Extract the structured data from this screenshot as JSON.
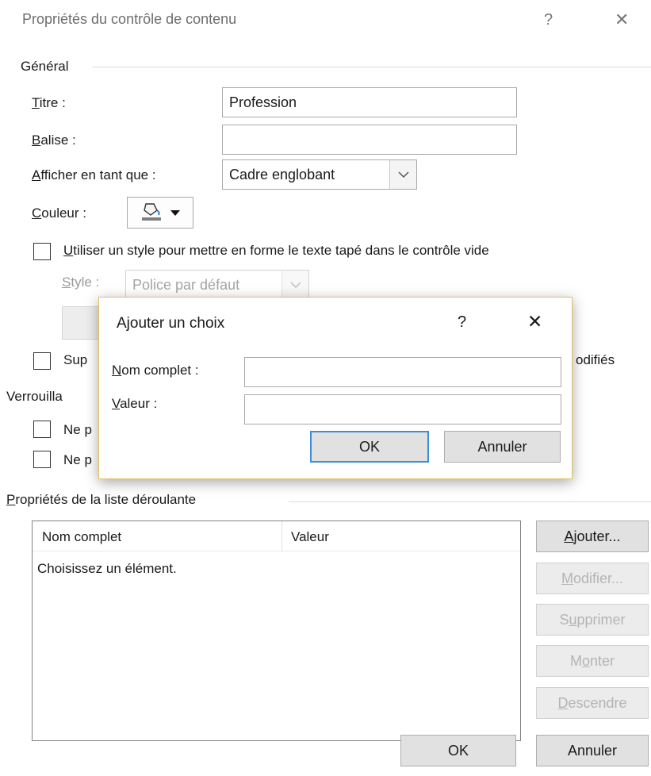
{
  "window": {
    "title": "Propriétés du contrôle de contenu",
    "help_glyph": "?",
    "close_glyph": "✕"
  },
  "general": {
    "group_label": "Général",
    "titre_label": "Titre :",
    "titre_value": "Profession",
    "balise_label": "Balise :",
    "balise_value": "",
    "afficher_label": "Afficher en tant que :",
    "afficher_value": "Cadre englobant",
    "couleur_label": "Couleur :",
    "couleur_icon": "paint-bucket-icon",
    "use_style_label": "Utiliser un style pour mettre en forme le texte tapé dans le contrôle vide",
    "use_style_checked": false,
    "style_label": "Style :",
    "style_value": "Police par défaut",
    "supprimer_label_start": "Sup",
    "supprimer_label_end": "odifiés"
  },
  "verrouillage": {
    "group_label_partial": "Verrouilla",
    "item1_partial": "Ne p",
    "item2_partial": "Ne p"
  },
  "liste": {
    "group_label": "Propriétés de la liste déroulante",
    "col_name": "Nom complet",
    "col_value": "Valeur",
    "rows": [
      {
        "name": "Choisissez un élément.",
        "value": ""
      }
    ],
    "buttons": {
      "ajouter": "Ajouter...",
      "modifier": "Modifier...",
      "supprimer": "Supprimer",
      "monter": "Monter",
      "descendre": "Descendre"
    }
  },
  "footer": {
    "ok": "OK",
    "annuler": "Annuler"
  },
  "modal": {
    "title": "Ajouter un choix",
    "help_glyph": "?",
    "close_glyph": "✕",
    "nom_label": "Nom complet :",
    "nom_value": "",
    "valeur_label": "Valeur :",
    "valeur_value": "",
    "ok": "OK",
    "annuler": "Annuler"
  },
  "colors": {
    "default_button_border": "#3a8fd6",
    "modal_border": "#e3c25b"
  }
}
